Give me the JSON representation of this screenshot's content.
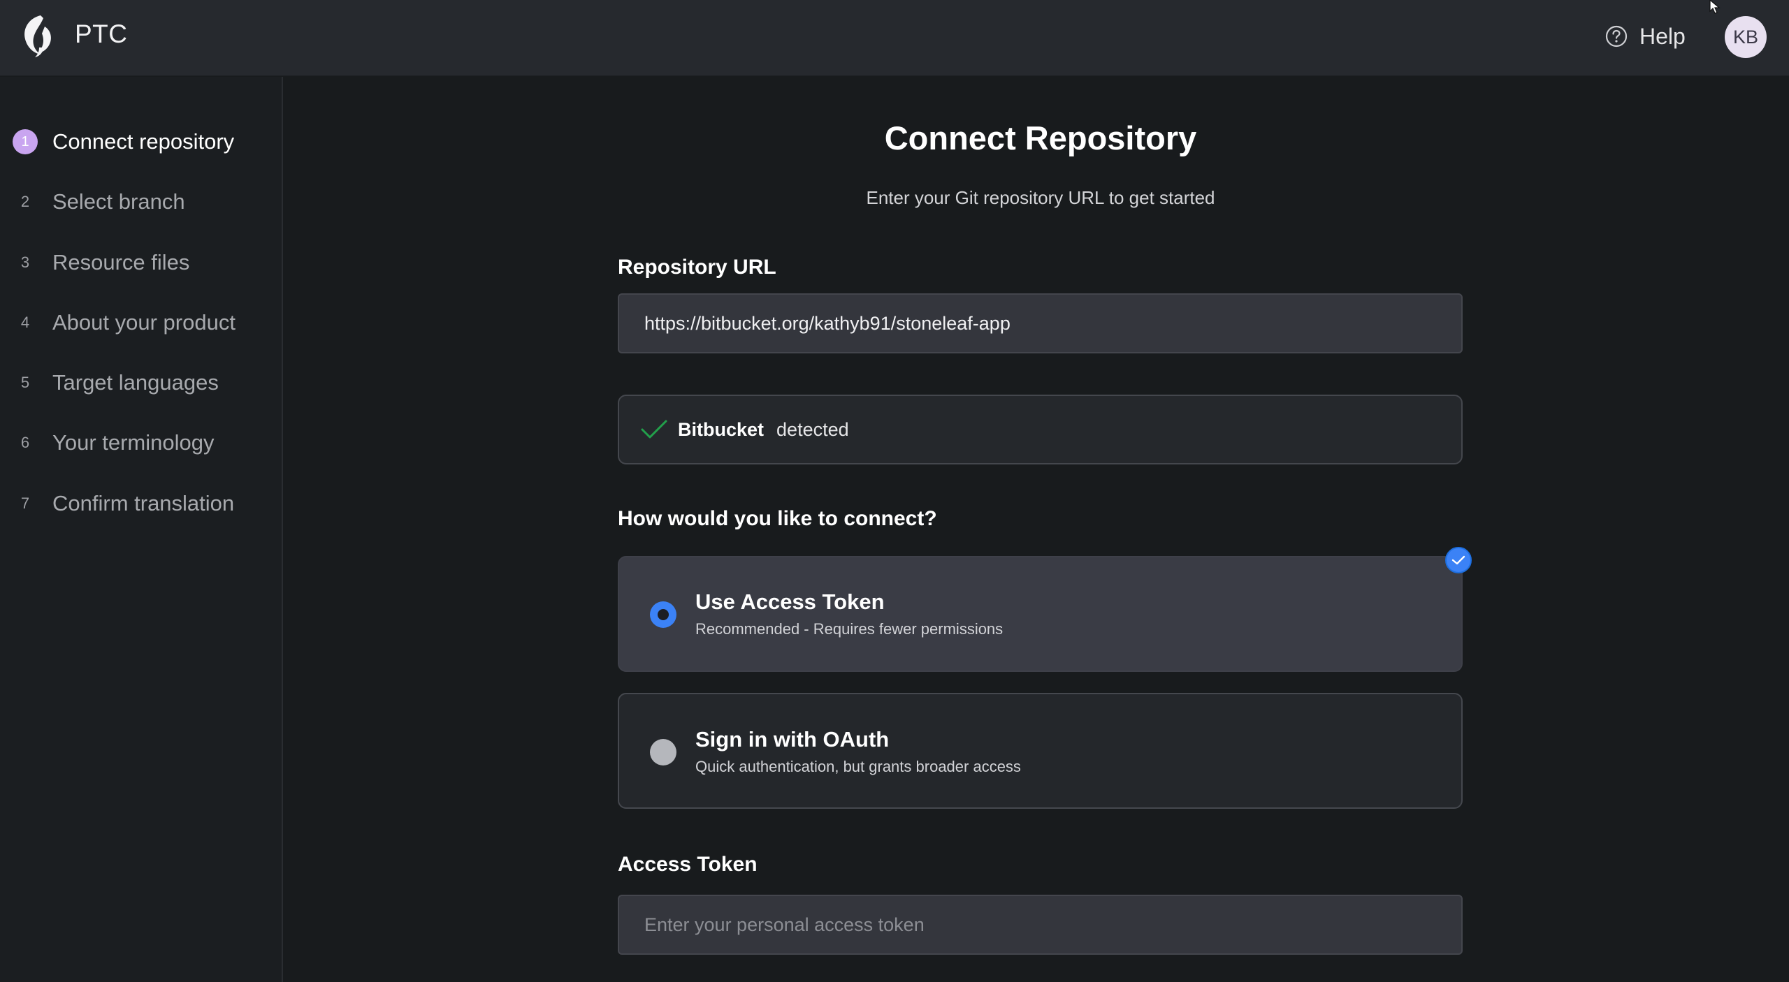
{
  "app": {
    "brand": "PTC",
    "logo_icon": "ptc-flame-logo",
    "help_label": "Help",
    "help_icon": "question-circle-icon",
    "user_initials": "KB"
  },
  "sidebar": {
    "steps": [
      {
        "num": "1",
        "label": "Connect repository",
        "active": true
      },
      {
        "num": "2",
        "label": "Select branch",
        "active": false
      },
      {
        "num": "3",
        "label": "Resource files",
        "active": false
      },
      {
        "num": "4",
        "label": "About your product",
        "active": false
      },
      {
        "num": "5",
        "label": "Target languages",
        "active": false
      },
      {
        "num": "6",
        "label": "Your terminology",
        "active": false
      },
      {
        "num": "7",
        "label": "Confirm translation",
        "active": false
      }
    ]
  },
  "main": {
    "title": "Connect Repository",
    "subtitle": "Enter your Git repository URL to get started",
    "repo_url_label": "Repository URL",
    "repo_url_value": "https://bitbucket.org/kathyb91/stoneleaf-app",
    "detection": {
      "icon": "checkmark-icon",
      "provider": "Bitbucket",
      "status": "detected"
    },
    "connect_question": "How would you like to connect?",
    "options": [
      {
        "title": "Use Access Token",
        "description": "Recommended - Requires fewer permissions",
        "selected": true
      },
      {
        "title": "Sign in with OAuth",
        "description": "Quick authentication, but grants broader access",
        "selected": false
      }
    ],
    "access_token_label": "Access Token",
    "access_token_placeholder": "Enter your personal access token"
  },
  "colors": {
    "accent_blue": "#3b82f6",
    "active_step": "#c9a5f0",
    "success_green": "#22a04b"
  }
}
